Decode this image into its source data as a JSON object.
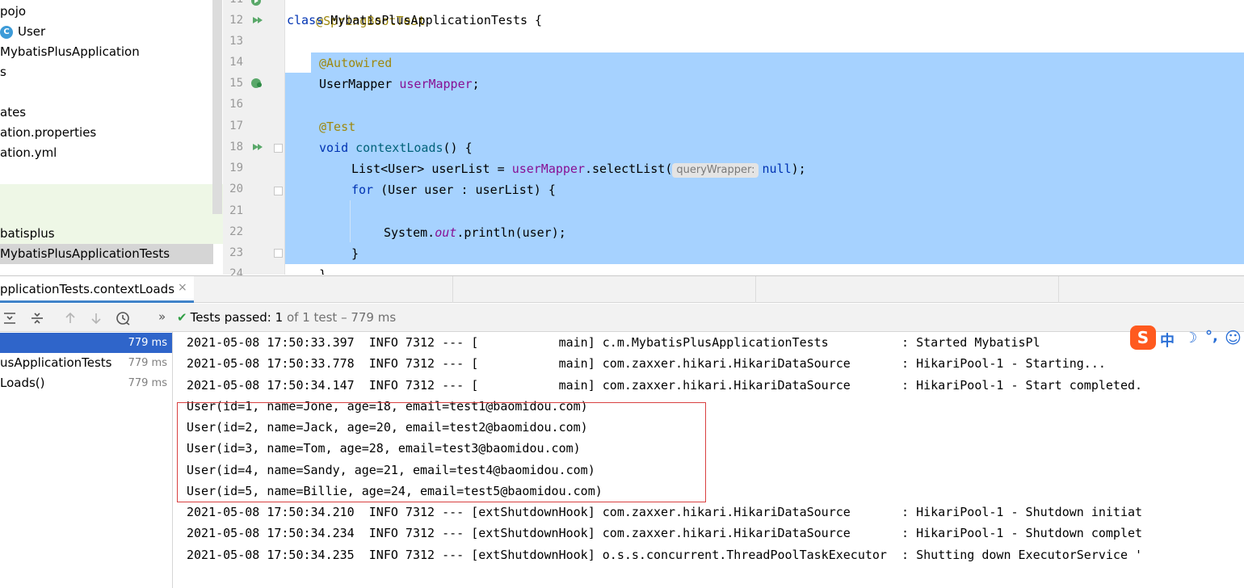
{
  "project_tree": {
    "items": [
      {
        "label": "pojo"
      },
      {
        "label": "User",
        "badge": "C"
      },
      {
        "label": "MybatisPlusApplication"
      },
      {
        "label": "s"
      },
      {
        "label": ""
      },
      {
        "label": "ates"
      },
      {
        "label": "ation.properties"
      },
      {
        "label": "ation.yml"
      },
      {
        "label": "batisplus"
      },
      {
        "label": "MybatisPlusApplicationTests"
      }
    ]
  },
  "editor": {
    "line_numbers": [
      "12",
      "13",
      "14",
      "15",
      "16",
      "17",
      "18",
      "19",
      "20",
      "21",
      "22",
      "23",
      "24"
    ],
    "top_partial": "@SpringBootTest",
    "lines": {
      "l12": {
        "kw": "class",
        "name": "MybatisPlusApplicationTests {"
      },
      "l14": {
        "ann": "@Autowired"
      },
      "l15": {
        "type": "UserMapper",
        "field": "userMapper",
        "end": ";"
      },
      "l17": {
        "ann": "@Test"
      },
      "l18": {
        "kw": "void",
        "method": "contextLoads",
        "end": "() {"
      },
      "l19": {
        "pre": "List<User> userList = ",
        "field": "userMapper",
        "call": ".selectList(",
        "hint": "queryWrapper:",
        "kw": "null",
        "end": ");"
      },
      "l20": {
        "kw": "for",
        "rest": " (User user : userList) {"
      },
      "l22": {
        "pre": "System.",
        "ital": "out",
        "rest": ".println(user);"
      },
      "l23": {
        "text": "}"
      },
      "l24": {
        "text": "}"
      }
    }
  },
  "run_window": {
    "tab_title": "pplicationTests.contextLoads",
    "tab_close": "×",
    "toolbar": {
      "check": "✔",
      "passed_label": "Tests passed:",
      "passed_count": "1",
      "passed_detail": "of 1 test – 779 ms",
      "more": "»"
    },
    "test_tree": [
      {
        "name": "",
        "duration": "779 ms",
        "selected": true
      },
      {
        "name": "usApplicationTests",
        "duration": "779 ms",
        "selected": false
      },
      {
        "name": "Loads()",
        "duration": "779 ms",
        "selected": false
      }
    ],
    "console_lines": [
      "2021-05-08 17:50:33.397  INFO 7312 --- [           main] c.m.MybatisPlusApplicationTests          : Started MybatisPl",
      "2021-05-08 17:50:33.778  INFO 7312 --- [           main] com.zaxxer.hikari.HikariDataSource       : HikariPool-1 - Starting...",
      "2021-05-08 17:50:34.147  INFO 7312 --- [           main] com.zaxxer.hikari.HikariDataSource       : HikariPool-1 - Start completed.",
      "User(id=1, name=Jone, age=18, email=test1@baomidou.com)",
      "User(id=2, name=Jack, age=20, email=test2@baomidou.com)",
      "User(id=3, name=Tom, age=28, email=test3@baomidou.com)",
      "User(id=4, name=Sandy, age=21, email=test4@baomidou.com)",
      "User(id=5, name=Billie, age=24, email=test5@baomidou.com)",
      "2021-05-08 17:50:34.210  INFO 7312 --- [extShutdownHook] com.zaxxer.hikari.HikariDataSource       : HikariPool-1 - Shutdown initiat",
      "2021-05-08 17:50:34.234  INFO 7312 --- [extShutdownHook] com.zaxxer.hikari.HikariDataSource       : HikariPool-1 - Shutdown complet",
      "2021-05-08 17:50:34.235  INFO 7312 --- [extShutdownHook] o.s.s.concurrent.ThreadPoolTaskExecutor  : Shutting down ExecutorService '"
    ]
  },
  "ime": {
    "logo": "S",
    "mode": "中",
    "moon": "☽",
    "punct": "°,",
    "emoji": "☺"
  },
  "colors": {
    "selection": "#a6d2ff",
    "keyword": "#0033b3",
    "annotation": "#9e880d",
    "field": "#871094",
    "selected_row": "#2f65ca",
    "pass_green": "#2f9e44",
    "highlight_box": "#d94040"
  }
}
